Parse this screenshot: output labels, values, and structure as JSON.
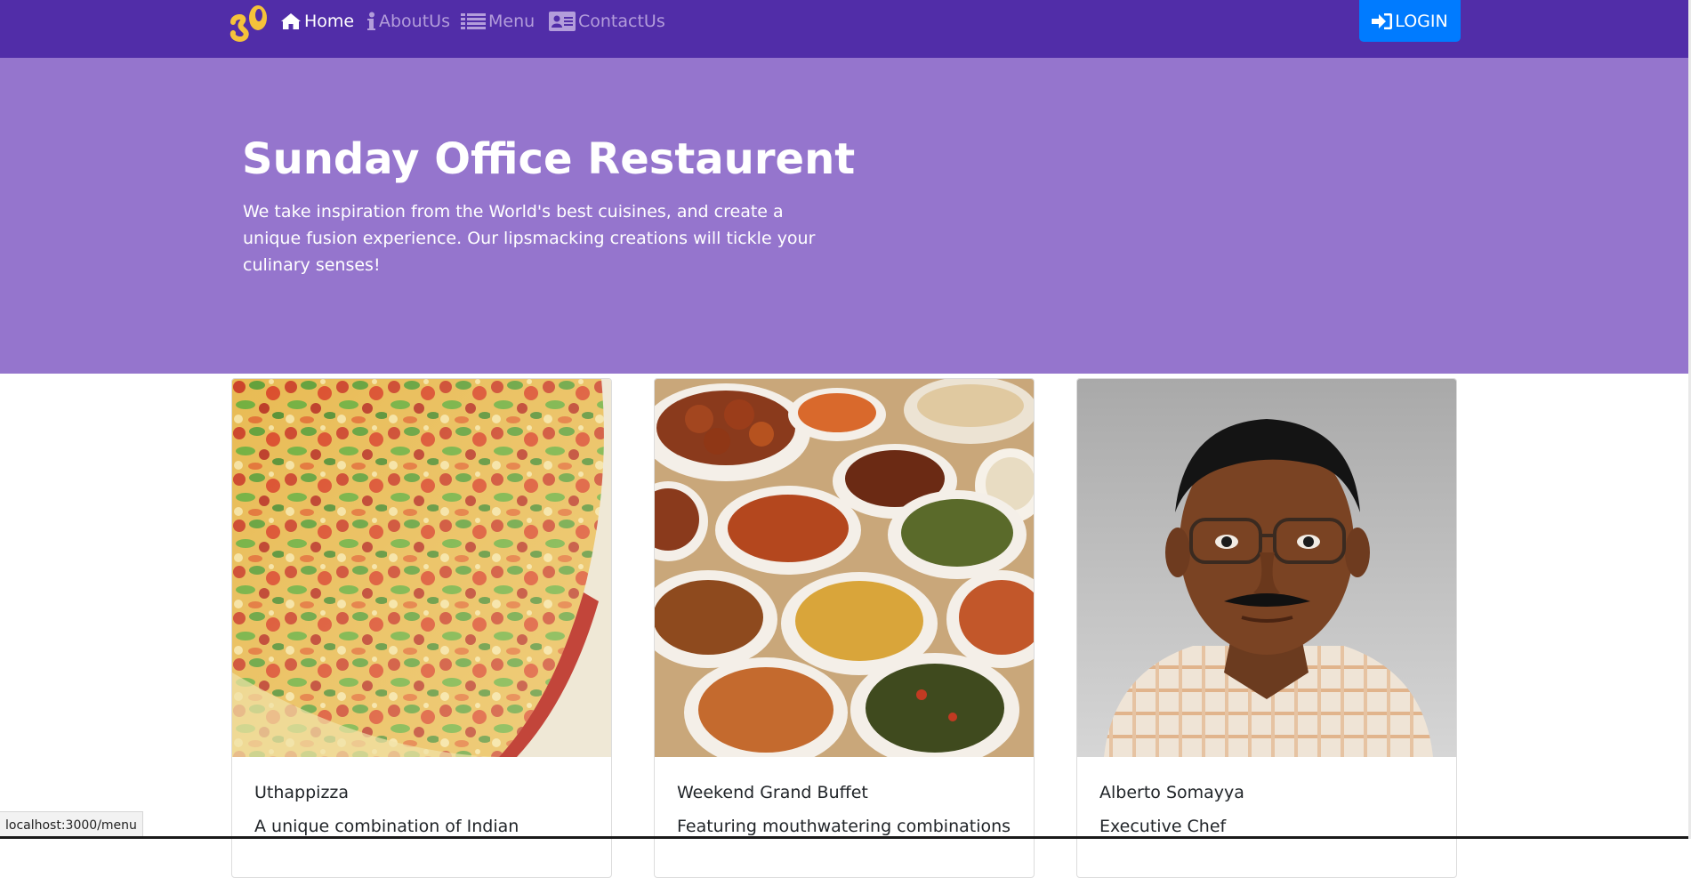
{
  "navbar": {
    "logo": "sunday-office-logo",
    "items": [
      {
        "label": "Home",
        "icon": "home-icon",
        "active": true
      },
      {
        "label": "AboutUs",
        "icon": "info-icon",
        "active": false
      },
      {
        "label": "Menu",
        "icon": "list-icon",
        "active": false
      },
      {
        "label": "ContactUs",
        "icon": "address-card-icon",
        "active": false
      }
    ],
    "login": {
      "label": "LOGIN",
      "icon": "sign-in-icon"
    }
  },
  "jumbotron": {
    "title": "Sunday Office Restaurent",
    "text": "We take inspiration from the World's best cuisines, and create a unique fusion experience. Our lipsmacking creations will tickle your culinary senses!"
  },
  "cards": [
    {
      "title": "Uthappizza",
      "subtitle": "",
      "text": "A unique combination of Indian",
      "image": "pizza-photo"
    },
    {
      "title": "Weekend Grand Buffet",
      "subtitle": "",
      "text": "Featuring mouthwatering combinations",
      "image": "buffet-photo"
    },
    {
      "title": "Alberto Somayya",
      "subtitle": "Executive Chef",
      "text": "",
      "image": "chef-portrait"
    }
  ],
  "status_bar": {
    "url": "localhost:3000/menu"
  },
  "colors": {
    "navbar": "#512da8",
    "jumbotron": "#9575cd",
    "nav_inactive": "#b39ddb",
    "login_button": "#007bff"
  }
}
